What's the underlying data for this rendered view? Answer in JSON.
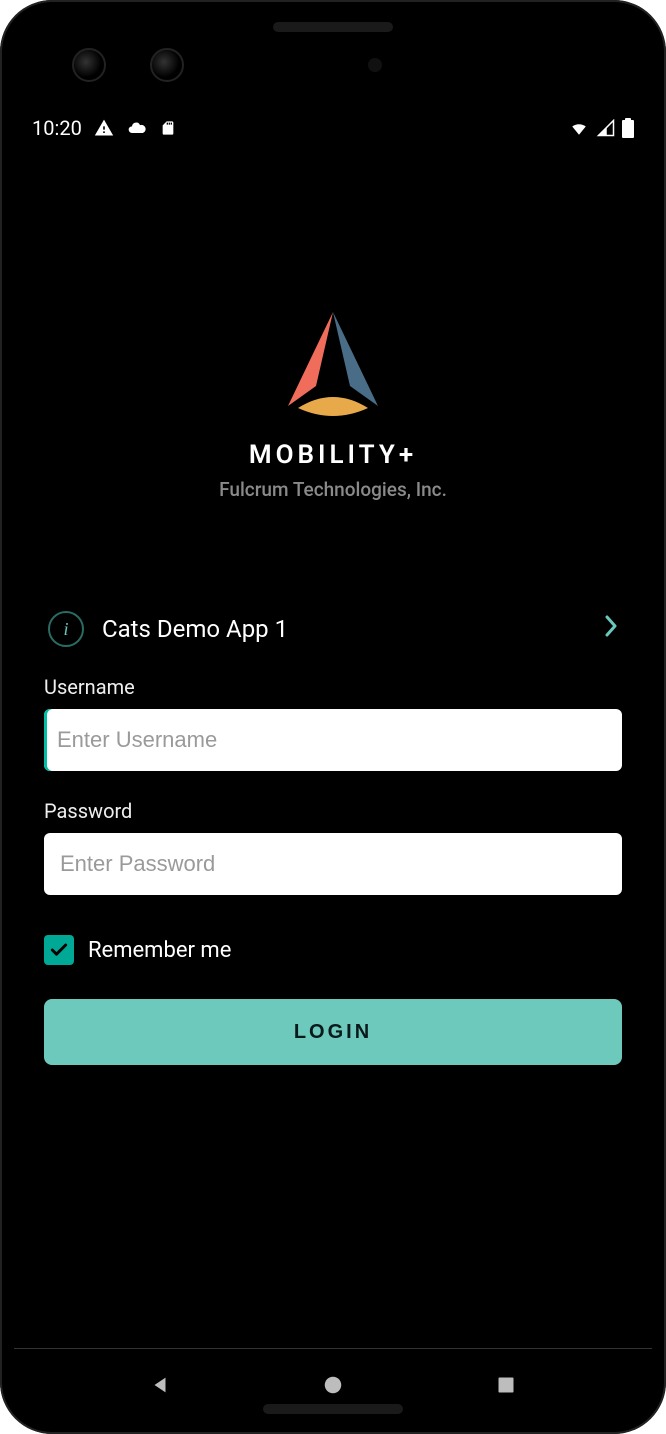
{
  "status": {
    "time": "10:20"
  },
  "branding": {
    "app_name": "MOBILITY+",
    "company": "Fulcrum Technologies, Inc."
  },
  "selector": {
    "info_glyph": "i",
    "selected_app": "Cats Demo App 1"
  },
  "form": {
    "username_label": "Username",
    "username_placeholder": "Enter Username",
    "username_value": "",
    "password_label": "Password",
    "password_placeholder": "Enter Password",
    "password_value": "",
    "remember_label": "Remember me",
    "remember_checked": true,
    "login_button": "LOGIN"
  },
  "colors": {
    "accent": "#6ec9bd",
    "checkbox": "#00a896"
  }
}
